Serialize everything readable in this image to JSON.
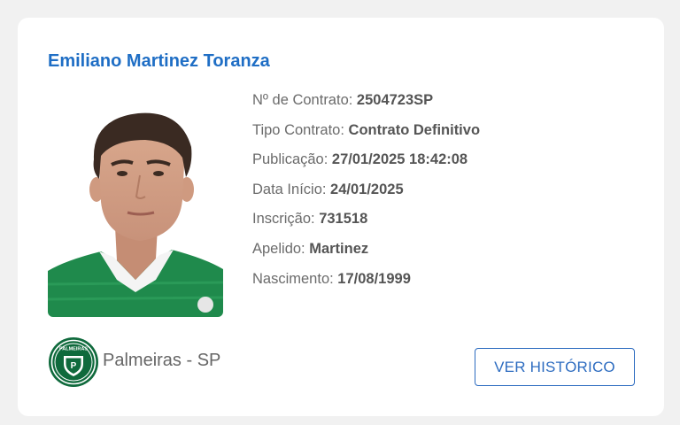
{
  "player": {
    "name": "Emiliano Martinez Toranza"
  },
  "details": [
    {
      "label": "Nº de Contrato: ",
      "value": "2504723SP"
    },
    {
      "label": "Tipo Contrato: ",
      "value": "Contrato Definitivo"
    },
    {
      "label": "Publicação: ",
      "value": "27/01/2025 18:42:08"
    },
    {
      "label": "Data Início: ",
      "value": "24/01/2025"
    },
    {
      "label": "Inscrição: ",
      "value": "731518"
    },
    {
      "label": "Apelido: ",
      "value": "Martinez"
    },
    {
      "label": "Nascimento: ",
      "value": "17/08/1999"
    }
  ],
  "club": {
    "name": "Palmeiras - SP",
    "logo_icon": "palmeiras-crest-icon",
    "logo_text": "PALMEIRAS",
    "logo_color": "#0f6a3c"
  },
  "actions": {
    "history_label": "VER HISTÓRICO"
  },
  "colors": {
    "name": "#1f6ec5",
    "button": "#2d6cc0",
    "background": "#f1f1f1",
    "card": "#ffffff",
    "jersey": "#1f8a4c"
  }
}
